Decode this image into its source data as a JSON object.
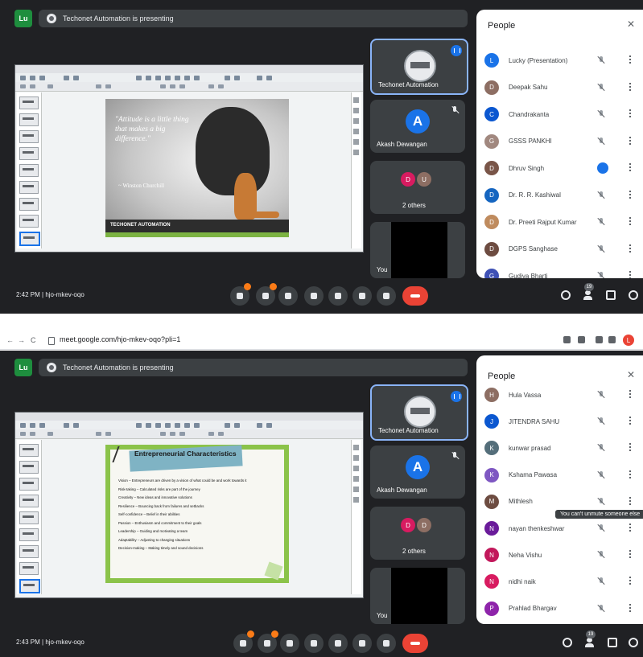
{
  "colors": {
    "meet_bg": "#202124",
    "tile": "#3c4043",
    "accent": "#1a73e8",
    "leave": "#ea4335"
  },
  "top": {
    "user_badge": "Lu",
    "banner_text": "Techonet Automation is presenting",
    "slide": {
      "quote": "\"Attitude is a little thing that makes a big difference.\"",
      "attribution": "~ Winston Churchill",
      "footer": "TECHONET AUTOMATION"
    },
    "tiles": [
      {
        "name": "Techonet Automation"
      },
      {
        "name": "Akash Dewangan",
        "initial": "A"
      },
      {
        "name": "2 others",
        "initials": [
          "D",
          "U"
        ]
      },
      {
        "name": "You"
      }
    ],
    "people": {
      "title": "People",
      "close_icon": "close-icon",
      "rows": [
        {
          "name": "Lucky (Presentation)",
          "initial": "L",
          "color": "#1a73e8",
          "state": "mic-off"
        },
        {
          "name": "Deepak Sahu",
          "initial": "D",
          "color": "#8d6e63",
          "state": "mic-off"
        },
        {
          "name": "Chandrakanta",
          "initial": "C",
          "color": "#0b57d0",
          "state": "mic-off"
        },
        {
          "name": "GSSS PANKHI",
          "initial": "G",
          "color": "#a1887f",
          "state": "mic-off"
        },
        {
          "name": "Dhruv Singh",
          "initial": "D",
          "color": "#795548",
          "state": "speaking"
        },
        {
          "name": "Dr. R. R. Kashiwal",
          "initial": "D",
          "color": "#1565c0",
          "state": "mic-off"
        },
        {
          "name": "Dr. Preeti Rajput Kumar",
          "initial": "D",
          "color": "#bf8b5e",
          "state": "mic-off"
        },
        {
          "name": "DGPS Sanghase",
          "initial": "D",
          "color": "#6d4c41",
          "state": "mic-off"
        },
        {
          "name": "Gudiya Bharti",
          "initial": "G",
          "color": "#3f51b5",
          "state": "mic-off"
        }
      ]
    },
    "bottom": {
      "time_code": "2:42 PM  |  hjo-mkev-oqo",
      "participants_count": "19"
    }
  },
  "browser": {
    "back": "←",
    "forward": "→",
    "reload": "C",
    "url": "meet.google.com/hjo-mkev-oqo?pli=1",
    "profile_initial": "L"
  },
  "bottom_section": {
    "user_badge": "Lu",
    "banner_text": "Techonet Automation is presenting",
    "slide": {
      "title": "Entrepreneurial Characteristics",
      "bullets": [
        "Vision – Entrepreneurs are driven by a vision of what could be and work towards it",
        "Risk-taking – Calculated risks are part of the journey",
        "Creativity – New ideas and innovative solutions",
        "Resilience – Bouncing back from failures and setbacks",
        "Self-confidence – Belief in their abilities",
        "Passion – Enthusiasm and commitment to their goals",
        "Leadership – Guiding and motivating a team",
        "Adaptability – Adjusting to changing situations",
        "Decision-making – Making timely and sound decisions"
      ]
    },
    "tiles": [
      {
        "name": "Techonet Automation"
      },
      {
        "name": "Akash Dewangan",
        "initial": "A"
      },
      {
        "name": "2 others",
        "initials": [
          "D",
          "D"
        ]
      },
      {
        "name": "You"
      }
    ],
    "people": {
      "title": "People",
      "rows": [
        {
          "name": "Hula Vassa",
          "initial": "H",
          "color": "#8d6e63",
          "state": "mic-off"
        },
        {
          "name": "JITENDRA SAHU",
          "initial": "J",
          "color": "#0b57d0",
          "state": "mic-off"
        },
        {
          "name": "kunwar prasad",
          "initial": "K",
          "color": "#546e7a",
          "state": "mic-off"
        },
        {
          "name": "Kshama Pawasa",
          "initial": "K",
          "color": "#7e57c2",
          "state": "mic-off"
        },
        {
          "name": "Mithlesh",
          "initial": "M",
          "color": "#6d4c41",
          "state": "mic-off"
        },
        {
          "name": "nayan thenkeshwar",
          "initial": "N",
          "color": "#6a1b9a",
          "state": "mic-off"
        },
        {
          "name": "Neha Vishu",
          "initial": "N",
          "color": "#c2185b",
          "state": "mic-off"
        },
        {
          "name": "nidhi naik",
          "initial": "N",
          "color": "#d81b60",
          "state": "mic-off"
        },
        {
          "name": "Prahlad Bhargav",
          "initial": "P",
          "color": "#8e24aa",
          "state": "mic-off"
        }
      ],
      "tooltip": "You can't unmute someone else"
    },
    "bottom": {
      "time_code": "2:43 PM  |  hjo-mkev-oqo",
      "participants_count": "19"
    }
  }
}
